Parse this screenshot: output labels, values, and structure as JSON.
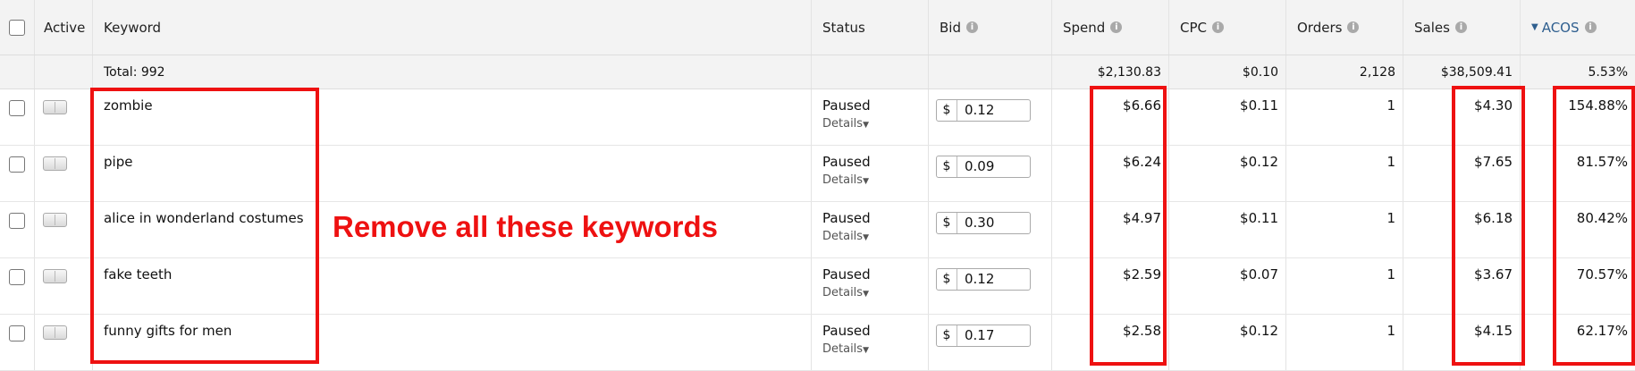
{
  "columns": {
    "active": "Active",
    "keyword": "Keyword",
    "status": "Status",
    "bid": "Bid",
    "spend": "Spend",
    "cpc": "CPC",
    "orders": "Orders",
    "sales": "Sales",
    "acos": "ACOS"
  },
  "totals": {
    "label": "Total: 992",
    "spend": "$2,130.83",
    "cpc": "$0.10",
    "orders": "2,128",
    "sales": "$38,509.41",
    "acos": "5.53%"
  },
  "rows": [
    {
      "keyword": "zombie",
      "status": "Paused",
      "details": "Details",
      "currency": "$",
      "bid": "0.12",
      "spend": "$6.66",
      "cpc": "$0.11",
      "orders": "1",
      "sales": "$4.30",
      "acos": "154.88%"
    },
    {
      "keyword": "pipe",
      "status": "Paused",
      "details": "Details",
      "currency": "$",
      "bid": "0.09",
      "spend": "$6.24",
      "cpc": "$0.12",
      "orders": "1",
      "sales": "$7.65",
      "acos": "81.57%"
    },
    {
      "keyword": "alice in wonderland costumes",
      "status": "Paused",
      "details": "Details",
      "currency": "$",
      "bid": "0.30",
      "spend": "$4.97",
      "cpc": "$0.11",
      "orders": "1",
      "sales": "$6.18",
      "acos": "80.42%"
    },
    {
      "keyword": "fake teeth",
      "status": "Paused",
      "details": "Details",
      "currency": "$",
      "bid": "0.12",
      "spend": "$2.59",
      "cpc": "$0.07",
      "orders": "1",
      "sales": "$3.67",
      "acos": "70.57%"
    },
    {
      "keyword": "funny gifts for men",
      "status": "Paused",
      "details": "Details",
      "currency": "$",
      "bid": "0.17",
      "spend": "$2.58",
      "cpc": "$0.12",
      "orders": "1",
      "sales": "$4.15",
      "acos": "62.17%"
    }
  ],
  "annotation": {
    "text": "Remove all these keywords",
    "color": "#ee1111"
  },
  "icons": {
    "info": "info-icon",
    "sort": "sort-desc-caret-icon"
  }
}
